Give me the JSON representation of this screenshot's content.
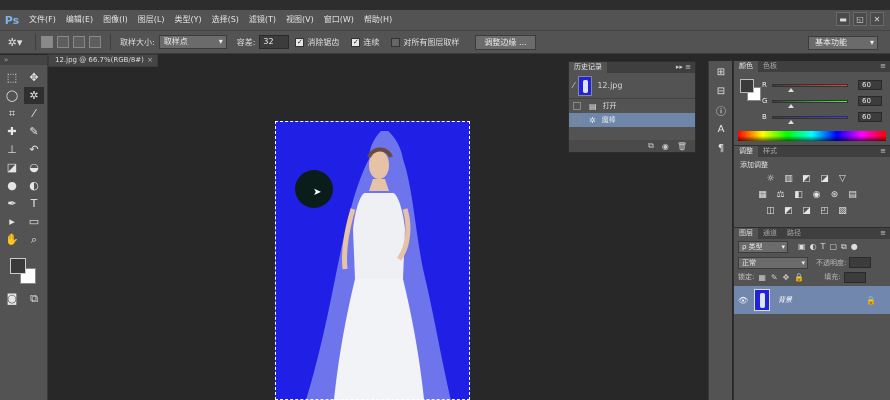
{
  "app": {
    "logo": "Ps"
  },
  "menu": [
    "文件(F)",
    "编辑(E)",
    "图像(I)",
    "图层(L)",
    "类型(Y)",
    "选择(S)",
    "滤镜(T)",
    "视图(V)",
    "窗口(W)",
    "帮助(H)"
  ],
  "window_controls": {
    "minimize": "▬",
    "restore": "◱",
    "close": "✕"
  },
  "options": {
    "tool_icon": "magic-wand-icon",
    "sample_size_label": "取样大小:",
    "sample_size_value": "取样点",
    "tolerance_label": "容差:",
    "tolerance_value": "32",
    "anti_alias_label": "消除锯齿",
    "contiguous_label": "连续",
    "sample_all_label": "对所有图层取样",
    "refine_edge_label": "调整边缘 ...",
    "workspace": "基本功能"
  },
  "document": {
    "tab": "12.jpg @ 66.7%(RGB/8#)",
    "close": "×"
  },
  "history": {
    "tab": "历史记录",
    "ctrl": "▸▸ ≡",
    "snapshot": "12.jpg",
    "rows": [
      {
        "label": "打开",
        "selected": false
      },
      {
        "label": "魔棒",
        "selected": true
      }
    ],
    "footer": [
      "⧉",
      "◉",
      "🗑"
    ]
  },
  "color": {
    "tabs": [
      "颜色",
      "色板"
    ],
    "r_label": "R",
    "r_value": "60",
    "g_label": "G",
    "g_value": "60",
    "b_label": "B",
    "b_value": "60",
    "fraction": 0.235
  },
  "adjustments": {
    "tabs": [
      "调整",
      "样式"
    ],
    "title": "添加调整"
  },
  "layers": {
    "tabs": [
      "图层",
      "通道",
      "路径"
    ],
    "kind": "ρ 类型",
    "blend": "正常",
    "opacity_label": "不透明度:",
    "lock_label": "锁定:",
    "fill_label": "填充:",
    "layer_name": "背景"
  }
}
